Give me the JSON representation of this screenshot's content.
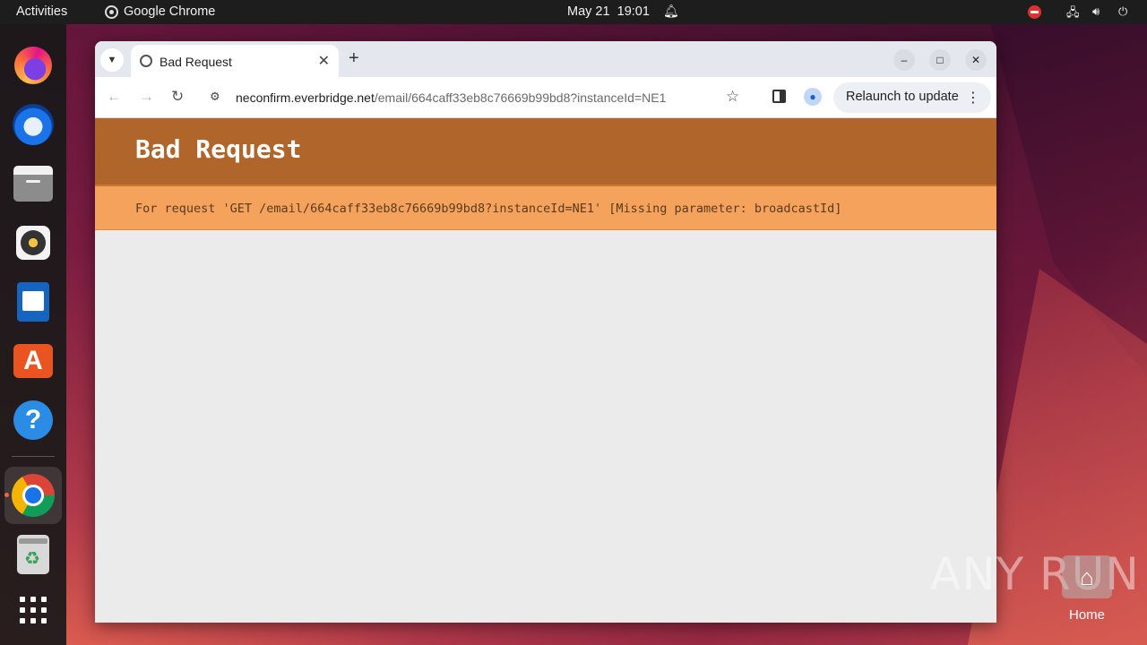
{
  "topbar": {
    "activities": "Activities",
    "app_name": "Google Chrome",
    "date": "May 21",
    "time": "19:01"
  },
  "dock": {
    "items": [
      "firefox",
      "thunderbird",
      "files",
      "rhythmbox",
      "libreoffice-writer",
      "app-center",
      "help",
      "google-chrome",
      "trash",
      "show-apps"
    ],
    "active": "google-chrome"
  },
  "browser": {
    "tab_title": "Bad Request",
    "url_host": "neconfirm.everbridge.net",
    "url_path": "/email/664caff33eb8c76669b99bd8?instanceId=NE1",
    "relaunch_label": "Relaunch to update"
  },
  "page": {
    "heading": "Bad Request",
    "message": "For request 'GET /email/664caff33eb8c76669b99bd8?instanceId=NE1' [Missing parameter: broadcastId]",
    "header_color": "#b0652a",
    "message_color": "#f5a35c"
  },
  "desktop": {
    "watermark": "ANY RUN",
    "home_label": "Home"
  }
}
